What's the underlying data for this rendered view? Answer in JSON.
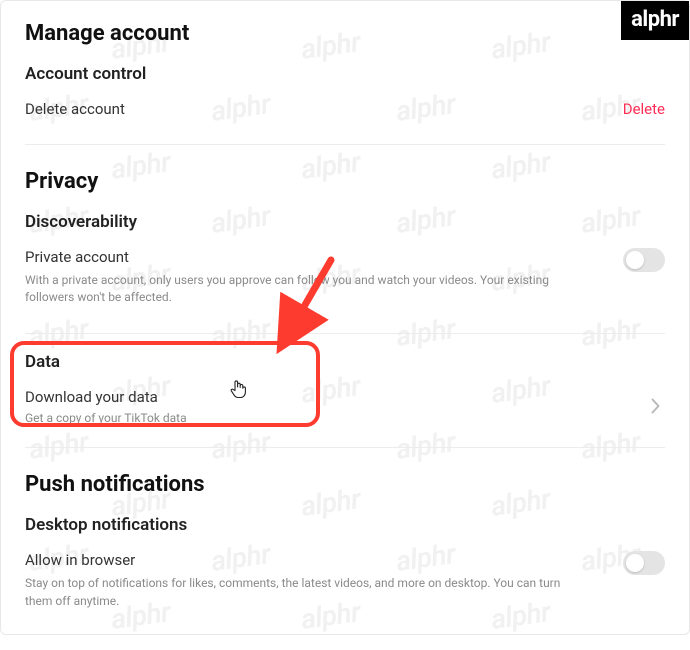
{
  "brand": {
    "logo_text": "alphr"
  },
  "sections": {
    "manage_account": {
      "title": "Manage account",
      "subsection": "Account control",
      "delete_label": "Delete account",
      "delete_action": "Delete"
    },
    "privacy": {
      "title": "Privacy",
      "discoverability": {
        "title": "Discoverability",
        "private_label": "Private account",
        "private_desc": "With a private account, only users you approve can follow you and watch your videos. Your existing followers won't be affected."
      },
      "data": {
        "title": "Data",
        "download_label": "Download your data",
        "download_desc": "Get a copy of your TikTok data"
      }
    },
    "push": {
      "title": "Push notifications",
      "desktop": {
        "title": "Desktop notifications",
        "allow_label": "Allow in browser",
        "allow_desc": "Stay on top of notifications for likes, comments, the latest videos, and more on desktop. You can turn them off anytime."
      }
    }
  },
  "watermark_text": "alphr"
}
